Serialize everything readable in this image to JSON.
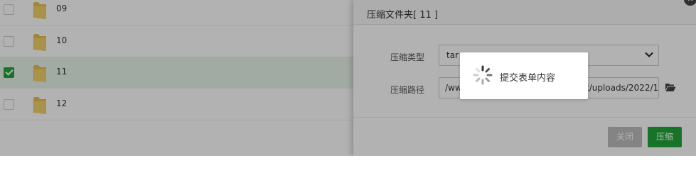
{
  "file_list": {
    "rows": [
      {
        "name": "09",
        "checked": false
      },
      {
        "name": "10",
        "checked": false
      },
      {
        "name": "11",
        "checked": true
      },
      {
        "name": "12",
        "checked": false
      }
    ]
  },
  "dialog": {
    "title": "压缩文件夹[ 11 ]",
    "close_icon": "×",
    "type_label": "压缩类型",
    "type_value": "tar",
    "path_label": "压缩路径",
    "path_prefix": "/ww",
    "path_suffix": "t/uploads/2022/1",
    "buttons": {
      "close_label": "关闭",
      "compress_label": "压缩"
    }
  },
  "loading": {
    "text": "提交表单内容"
  },
  "colors": {
    "accent_green": "#20a53a",
    "disabled_gray": "#bdbdbd",
    "folder_yellow": "#e8c04c"
  },
  "icons": {
    "folder": "folder-icon",
    "folder_open": "folder-open-icon",
    "chevron": "chevron-down-icon",
    "spinner": "spinner-icon",
    "close": "close-icon"
  }
}
